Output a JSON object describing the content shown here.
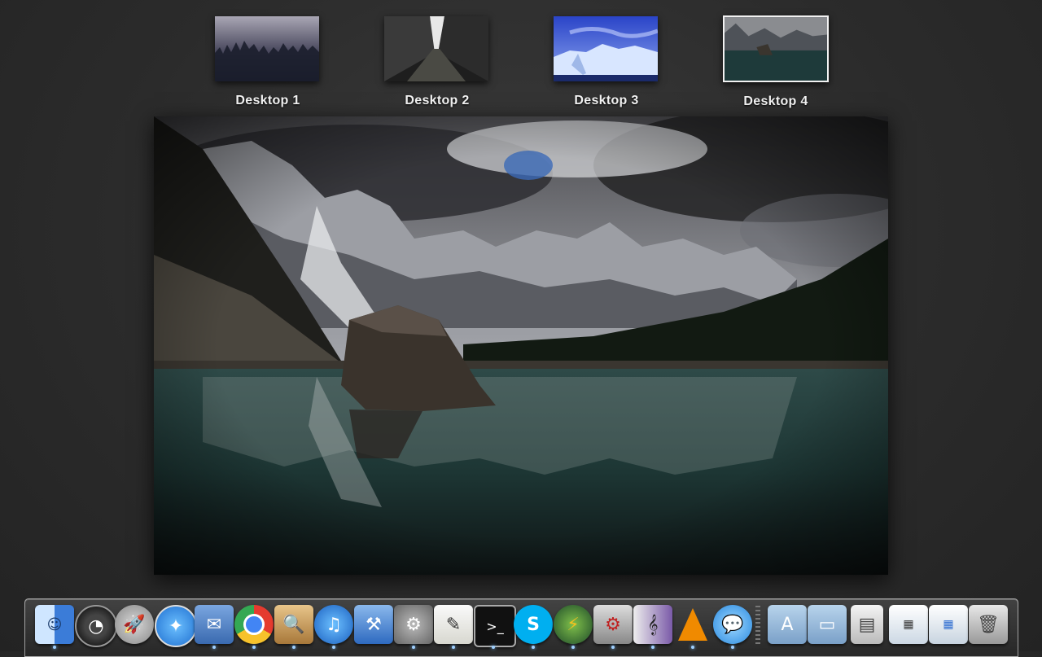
{
  "spaces": {
    "desktops": [
      {
        "label": "Desktop 1",
        "active": false
      },
      {
        "label": "Desktop 2",
        "active": false
      },
      {
        "label": "Desktop 3",
        "active": false
      },
      {
        "label": "Desktop 4",
        "active": true
      }
    ]
  },
  "colors": {
    "background": "#2b2b2b",
    "label": "#f4f4f4",
    "running_indicator": "#9fd0ff"
  },
  "dock": {
    "items": [
      {
        "name": "Finder",
        "icon": "finder-icon",
        "running": true
      },
      {
        "name": "Dashboard",
        "icon": "dashboard-icon",
        "running": false
      },
      {
        "name": "Launchpad",
        "icon": "launchpad-icon",
        "running": false
      },
      {
        "name": "Safari",
        "icon": "safari-icon",
        "running": false
      },
      {
        "name": "Mail",
        "icon": "mail-icon",
        "running": true
      },
      {
        "name": "Google Chrome",
        "icon": "chrome-icon",
        "running": true
      },
      {
        "name": "Preview",
        "icon": "preview-icon",
        "running": true
      },
      {
        "name": "iTunes",
        "icon": "itunes-icon",
        "running": true
      },
      {
        "name": "Xcode",
        "icon": "xcode-icon",
        "running": false
      },
      {
        "name": "System Preferences",
        "icon": "system-preferences-icon",
        "running": true
      },
      {
        "name": "TextEdit",
        "icon": "textedit-icon",
        "running": true
      },
      {
        "name": "Terminal",
        "icon": "terminal-icon",
        "running": true
      },
      {
        "name": "Skype",
        "icon": "skype-icon",
        "running": true
      },
      {
        "name": "FileZilla",
        "icon": "filezilla-icon",
        "running": true
      },
      {
        "name": "Transmission",
        "icon": "transmission-icon",
        "running": true
      },
      {
        "name": "Sibelius",
        "icon": "sibelius-icon",
        "running": true
      },
      {
        "name": "VLC",
        "icon": "vlc-icon",
        "running": true
      },
      {
        "name": "Messages",
        "icon": "messages-icon",
        "running": true
      }
    ],
    "stacks": [
      {
        "name": "Applications",
        "icon": "applications-folder-icon"
      },
      {
        "name": "Documents",
        "icon": "documents-folder-icon"
      },
      {
        "name": "Archive",
        "icon": "archive-icon"
      },
      {
        "name": "Downloads window",
        "icon": "window-chrome-icon"
      },
      {
        "name": "Window",
        "icon": "window-itunes-icon"
      },
      {
        "name": "Trash",
        "icon": "trash-icon"
      }
    ]
  }
}
